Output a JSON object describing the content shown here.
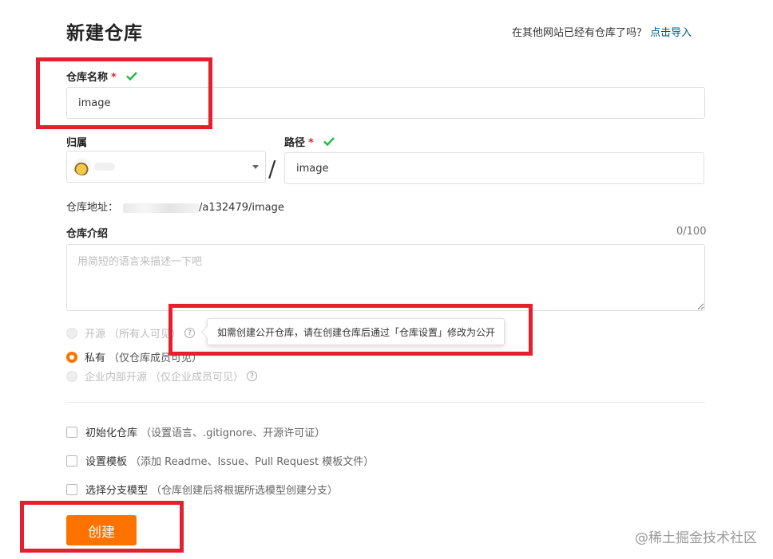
{
  "header": {
    "title": "新建仓库",
    "import_question": "在其他网站已经有仓库了吗？",
    "import_link": "点击导入"
  },
  "repo_name": {
    "label": "仓库名称",
    "required_mark": "*",
    "value": "image"
  },
  "owner": {
    "label": "归属"
  },
  "separator": "/",
  "path": {
    "label": "路径",
    "required_mark": "*",
    "value": "image"
  },
  "address": {
    "label": "仓库地址：",
    "suffix": "/a132479/image"
  },
  "intro": {
    "label": "仓库介绍",
    "counter": "0/100",
    "placeholder": "用简短的语言来描述一下吧"
  },
  "visibility": {
    "options": [
      {
        "label": "开源",
        "hint": "（所有人可见）",
        "selected": false,
        "disabled": true
      },
      {
        "label": "私有",
        "hint": "（仅仓库成员可见）",
        "selected": true,
        "disabled": false
      },
      {
        "label": "企业内部开源",
        "hint": "（仅企业成员可见）",
        "selected": false,
        "disabled": true
      }
    ],
    "help_icon": "question-circle-icon",
    "tooltip": "如需创建公开仓库，请在创建仓库后通过「仓库设置」修改为公开"
  },
  "options": [
    {
      "label": "初始化仓库",
      "hint": "（设置语言、.gitignore、开源许可证）"
    },
    {
      "label": "设置模板",
      "hint": "（添加 Readme、Issue、Pull Request 模板文件）"
    },
    {
      "label": "选择分支模型",
      "hint": "（仓库创建后将根据所选模型创建分支）"
    }
  ],
  "submit": {
    "label": "创建"
  },
  "watermark": "@稀土掘金技术社区",
  "colors": {
    "accent": "#fe7300",
    "link": "#005980",
    "required": "#db2828",
    "valid_check": "#21ba45",
    "annotation_box": "#e5202e"
  }
}
